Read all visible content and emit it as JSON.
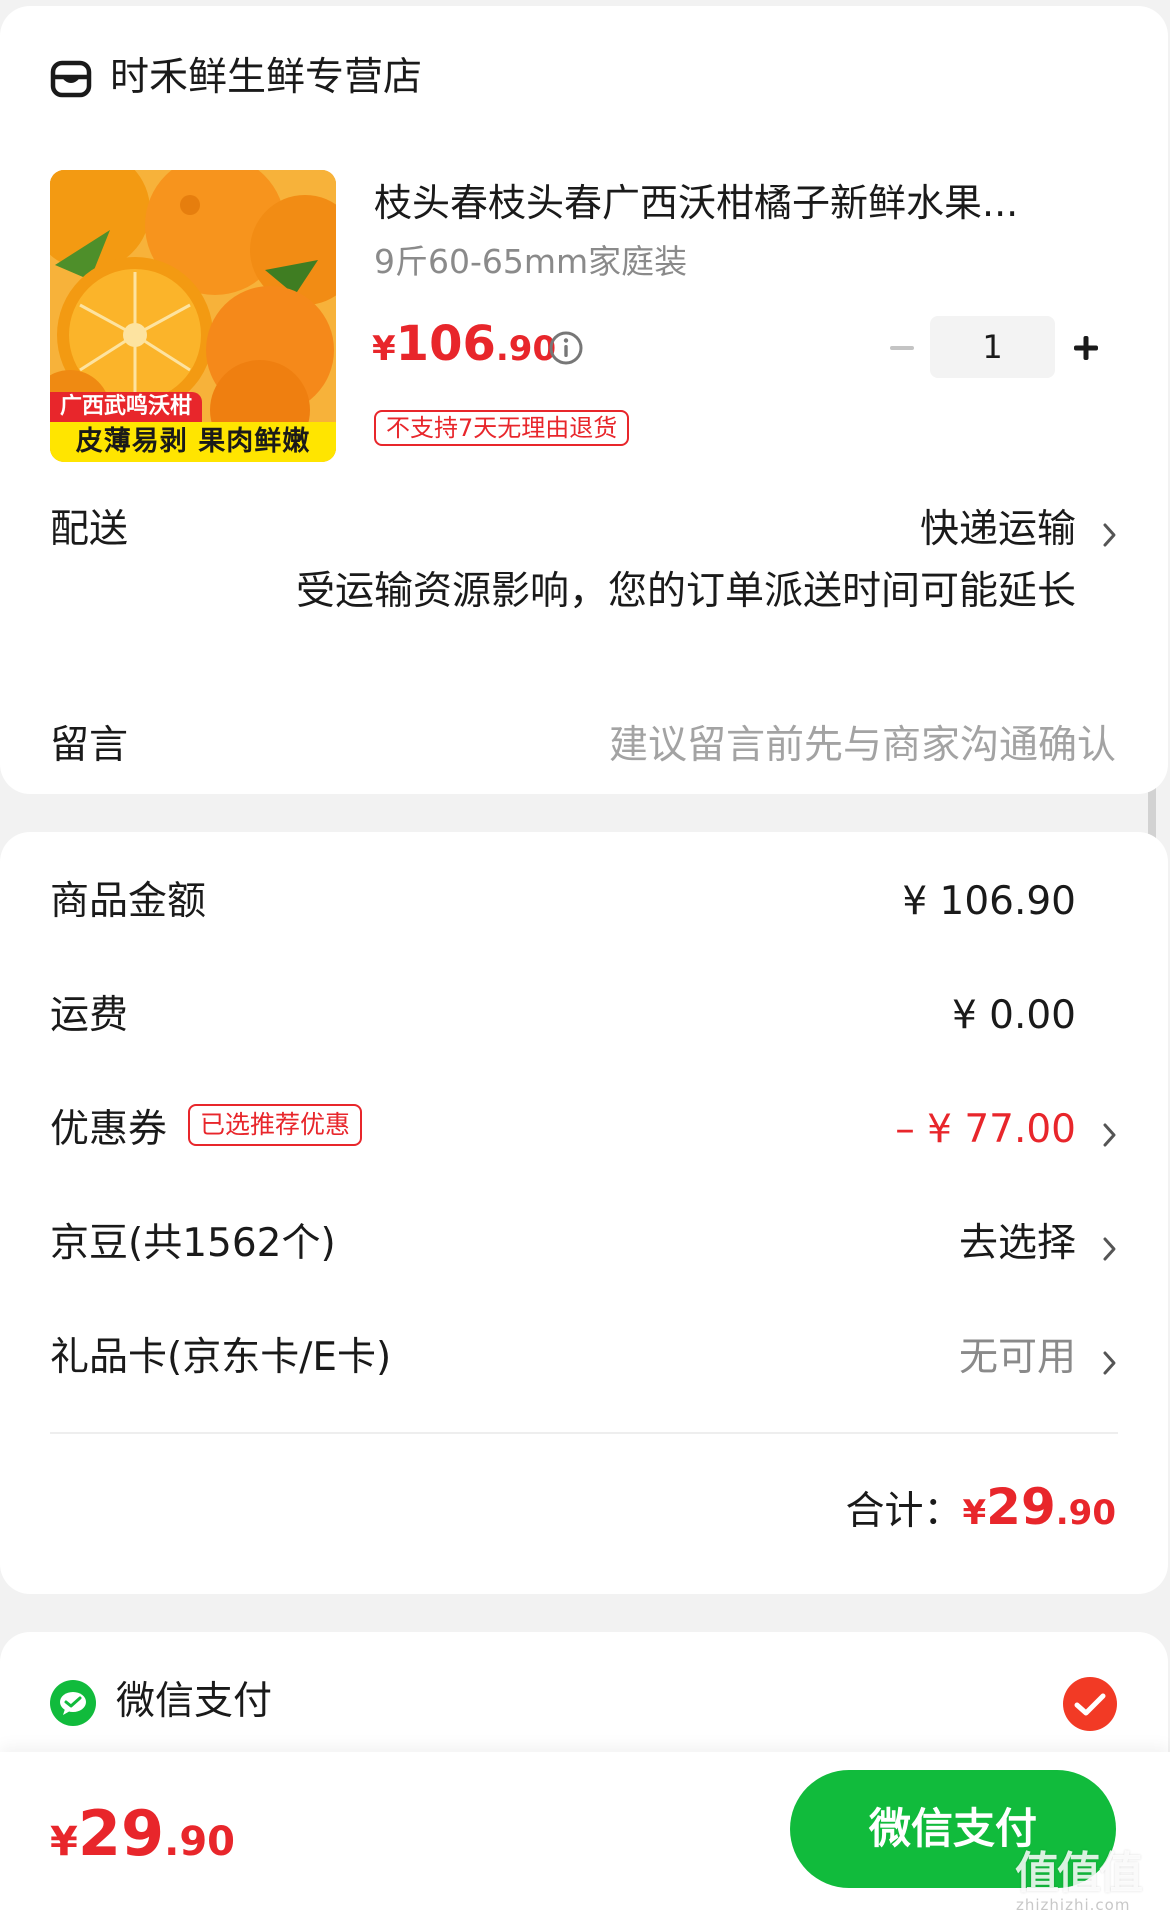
{
  "store": {
    "name": "时禾鲜生鲜专营店",
    "icon": "store-icon"
  },
  "product": {
    "title": "枝头春枝头春广西沃柑橘子新鲜水果...",
    "spec": "9斤60-65mm家庭装",
    "price_currency": "¥",
    "price_int": "106",
    "price_dec": ".90",
    "quantity": "1",
    "return_policy": "不支持7天无理由退货",
    "image_tag_top": "广西武鸣沃柑",
    "image_tag_bottom": "皮薄易剥 果肉鲜嫩"
  },
  "delivery": {
    "label": "配送",
    "method": "快递运输",
    "notice": "受运输资源影响，您的订单派送时间可能延长"
  },
  "message": {
    "label": "留言",
    "placeholder": "建议留言前先与商家沟通确认"
  },
  "summary": {
    "goods_amount_label": "商品金额",
    "goods_amount_value": "¥ 106.90",
    "shipping_label": "运费",
    "shipping_value": "¥ 0.00",
    "coupon_label": "优惠券",
    "coupon_badge": "已选推荐优惠",
    "coupon_value": "– ¥ 77.00",
    "jingdou_label": "京豆(共1562个)",
    "jingdou_value": "去选择",
    "giftcard_label": "礼品卡(京东卡/E卡)",
    "giftcard_value": "无可用",
    "total_label": "合计：",
    "total_currency": "¥",
    "total_int": "29",
    "total_dec": ".90"
  },
  "payment": {
    "method_label": "微信支付",
    "selected": true
  },
  "bottom_bar": {
    "price_currency": "¥",
    "price_int": "29",
    "price_dec": ".90",
    "pay_button_label": "微信支付",
    "watermark": "值值值",
    "watermark_sub": "zhizhizhi.com"
  },
  "colors": {
    "accent_red": "#e8262b",
    "wechat_green": "#11bb3c"
  }
}
